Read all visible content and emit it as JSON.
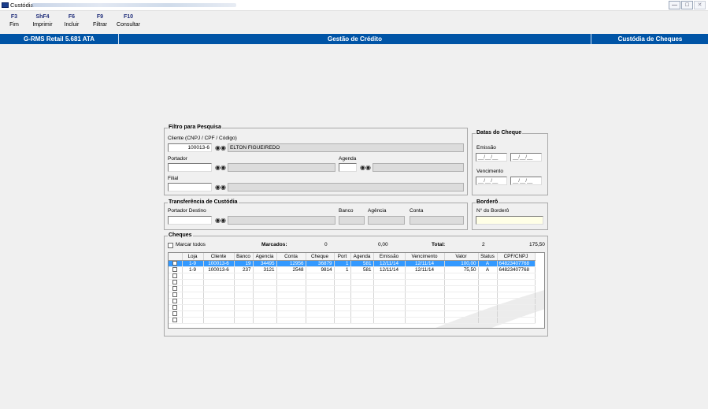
{
  "window": {
    "title": "Custódia"
  },
  "toolbar": [
    {
      "key": "F3",
      "label": "Fim"
    },
    {
      "key": "ShF4",
      "label": "Imprimir"
    },
    {
      "key": "F6",
      "label": "Incluir"
    },
    {
      "key": "F9",
      "label": "Filtrar"
    },
    {
      "key": "F10",
      "label": "Consultar"
    }
  ],
  "header": {
    "left": "G-RMS Retail 5.681 ATA",
    "middle": "Gestão de Crédito",
    "right": "Custódia de Cheques"
  },
  "filtro": {
    "title": "Filtro para Pesquisa",
    "cliente_label": "Cliente (CNPJ / CPF / Código)",
    "cliente_value": "100013-6",
    "cliente_nome": "ELTON FIGUEIREDO",
    "portador_label": "Portador",
    "portador_value": "",
    "agenda_label": "Agenda",
    "agenda_value": "",
    "filial_label": "Filial",
    "filial_value": ""
  },
  "datas": {
    "title": "Datas do Cheque",
    "emissao_label": "Emissão",
    "vencimento_label": "Vencimento",
    "date_placeholder": "__/__/__"
  },
  "transferencia": {
    "title": "Transferência de Custódia",
    "portador_destino_label": "Portador Destino",
    "banco_label": "Banco",
    "agencia_label": "Agência",
    "conta_label": "Conta"
  },
  "bordero": {
    "title": "Borderô",
    "numero_label": "N° do Borderô",
    "numero_value": ""
  },
  "cheques": {
    "title": "Cheques",
    "marcar_todos": "Marcar todos",
    "marcados_label": "Marcados:",
    "marcados_count": "0",
    "marcados_valor": "0,00",
    "total_label": "Total:",
    "total_count": "2",
    "total_valor": "175,50",
    "columns": [
      "",
      "Loja",
      "Cliente",
      "Banco",
      "Agencia",
      "Conta",
      "Cheque",
      "Port",
      "Agenda",
      "Emissão",
      "Vencimento",
      "Valor",
      "Status",
      "CPF/CNPJ"
    ],
    "rows": [
      {
        "selected": true,
        "cells": [
          "",
          "1-9",
          "100013-6",
          "19",
          "34495",
          "12956",
          "36879",
          "1",
          "581",
          "12/11/14",
          "12/11/14",
          "100,00",
          "A",
          "64823407768"
        ]
      },
      {
        "selected": false,
        "cells": [
          "",
          "1-9",
          "100013-6",
          "237",
          "3121",
          "2548",
          "9814",
          "1",
          "581",
          "12/11/14",
          "12/11/14",
          "75,50",
          "A",
          "64823407768"
        ]
      }
    ],
    "empty_rows": 8
  },
  "icons": {
    "search": "binoculars-icon",
    "window_controls": [
      "minimize-icon",
      "maximize-icon",
      "close-icon"
    ]
  },
  "colors": {
    "header_bg": "#0054a6",
    "selection": "#3399ff",
    "toolbar_key": "#1f2d7a"
  }
}
